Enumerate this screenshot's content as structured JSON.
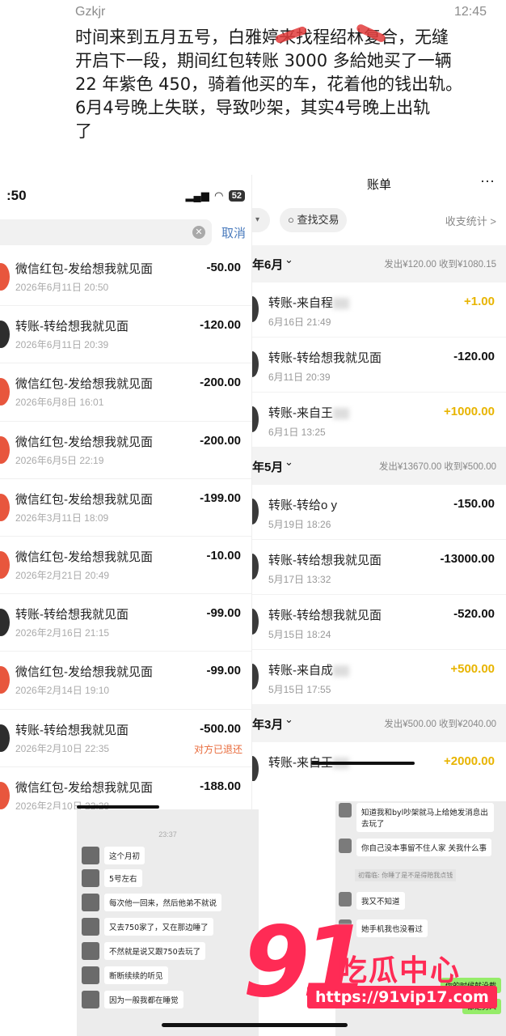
{
  "post": {
    "username": "Gzkjr",
    "time": "12:45",
    "lines": [
      "时间来到五月五号，白雅婷来找程绍林复合，无缝",
      "开启下一段，期间红包转账 3000 多給她买了一辆",
      "22 年紫色 450，骑着他买的车，花着他的钱出轨。",
      "6月4号晚上失联，导致吵架，其实4号晚上出轨",
      "了"
    ]
  },
  "left_phone": {
    "status_time": ":50",
    "battery": "52",
    "cancel_label": "取消",
    "rows": [
      {
        "title": "微信红包-发给想我就见面",
        "date": "2026年6月11日 20:50",
        "amount": "-50.00",
        "kind": "red"
      },
      {
        "title": "转账-转给想我就见面",
        "date": "2026年6月11日 20:39",
        "amount": "-120.00",
        "kind": "transfer"
      },
      {
        "title": "微信红包-发给想我就见面",
        "date": "2026年6月8日 16:01",
        "amount": "-200.00",
        "kind": "red"
      },
      {
        "title": "微信红包-发给想我就见面",
        "date": "2026年6月5日 22:19",
        "amount": "-200.00",
        "kind": "red"
      },
      {
        "title": "微信红包-发给想我就见面",
        "date": "2026年3月11日 18:09",
        "amount": "-199.00",
        "kind": "red"
      },
      {
        "title": "微信红包-发给想我就见面",
        "date": "2026年2月21日 20:49",
        "amount": "-10.00",
        "kind": "red"
      },
      {
        "title": "转账-转给想我就见面",
        "date": "2026年2月16日 21:15",
        "amount": "-99.00",
        "kind": "transfer"
      },
      {
        "title": "微信红包-发给想我就见面",
        "date": "2026年2月14日 19:10",
        "amount": "-99.00",
        "kind": "red"
      },
      {
        "title": "转账-转给想我就见面",
        "date": "2026年2月10日 22:35",
        "amount": "-500.00",
        "kind": "transfer",
        "refund": "对方已退还"
      },
      {
        "title": "微信红包-发给想我就见面",
        "date": "2026年2月10日 22:28",
        "amount": "-188.00",
        "kind": "red"
      }
    ]
  },
  "bill": {
    "title": "账单",
    "more": "···",
    "find_label": "查找交易",
    "stats_label": "收支统计 >",
    "months": [
      {
        "label": "年6月",
        "summary": "发出¥120.00  收到¥1080.15",
        "rows": [
          {
            "title": "转账-来自程",
            "date": "6月16日 21:49",
            "amount": "+1.00",
            "pos": true
          },
          {
            "title": "转账-转给想我就见面",
            "date": "6月11日 20:39",
            "amount": "-120.00",
            "pos": false
          },
          {
            "title": "转账-来自王",
            "date": "6月1日 13:25",
            "amount": "+1000.00",
            "pos": true
          }
        ]
      },
      {
        "label": "年5月",
        "summary": "发出¥13670.00  收到¥500.00",
        "rows": [
          {
            "title": "转账-转给o y",
            "date": "5月19日 18:26",
            "amount": "-150.00",
            "pos": false
          },
          {
            "title": "转账-转给想我就见面",
            "date": "5月17日 13:32",
            "amount": "-13000.00",
            "pos": false
          },
          {
            "title": "转账-转给想我就见面",
            "date": "5月15日 18:24",
            "amount": "-520.00",
            "pos": false
          },
          {
            "title": "转账-来自成",
            "date": "5月15日 17:55",
            "amount": "+500.00",
            "pos": true
          }
        ]
      },
      {
        "label": "年3月",
        "summary": "发出¥500.00  收到¥2040.00",
        "rows": [
          {
            "title": "转账-来自王",
            "date": "",
            "amount": "+2000.00",
            "pos": true
          }
        ]
      }
    ]
  },
  "chat_left": {
    "time": "23:37",
    "messages": [
      "这个月初",
      "5号左右",
      "每次他一回来，然后他弟不就说",
      "又去750家了，又在那边睡了",
      "不然就是说又跟750去玩了",
      "断断续续的听见",
      "因为一般我都在睡觉"
    ]
  },
  "chat_right": {
    "messages": [
      "知道我和byl吵架就马上给她发消息出去玩了",
      "你自己没本事留不住人家 关我什么事",
      "我又不知道",
      "她手机我也没看过"
    ],
    "note": "初霜临: 你睡了是不是得赔我点钱",
    "green": [
      "你的时候就没截",
      "都是男人"
    ]
  },
  "watermark": {
    "number": "91",
    "name": "吃瓜中心",
    "url": "https://91vip17.com"
  },
  "colors": {
    "accent_red": "#ff2b55",
    "income_yellow": "#e8b400",
    "link_blue": "#4a7bbd",
    "refund_orange": "#e86a3a"
  }
}
